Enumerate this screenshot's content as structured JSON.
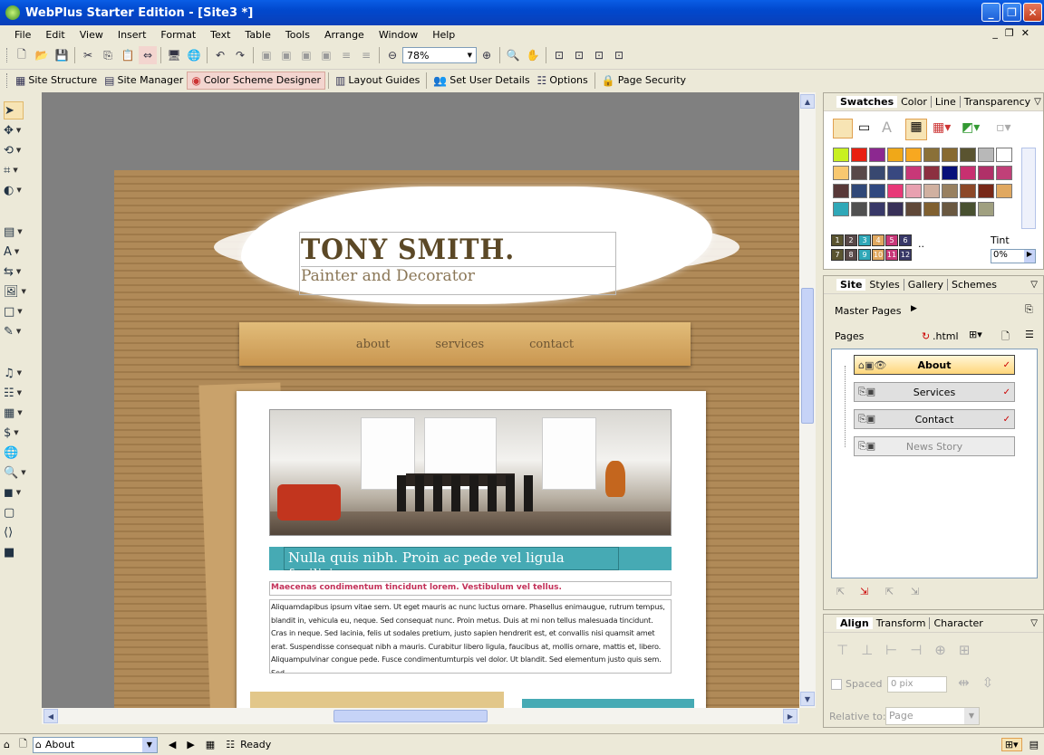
{
  "window": {
    "title": "WebPlus Starter Edition    - [Site3 *]"
  },
  "menu": [
    "File",
    "Edit",
    "View",
    "Insert",
    "Format",
    "Text",
    "Table",
    "Tools",
    "Arrange",
    "Window",
    "Help"
  ],
  "zoom": "78%",
  "toolbar2": {
    "site_structure": "Site Structure",
    "site_manager": "Site Manager",
    "color_scheme": "Color Scheme Designer",
    "layout_guides": "Layout Guides",
    "set_user_details": "Set User Details",
    "options": "Options",
    "page_security": "Page Security"
  },
  "page": {
    "name": "TONY SMITH.",
    "subtitle": "Painter and Decorator",
    "nav": [
      "about",
      "services",
      "contact"
    ],
    "banner": "Nulla quis nibh. Proin ac pede vel ligula facilisis",
    "red_heading": "Maecenas condimentum tincidunt lorem. Vestibulum vel tellus.",
    "body": "Aliquamdapibus ipsum vitae sem. Ut eget mauris ac nunc luctus ornare. Phasellus enimaugue, rutrum tempus, blandit in, vehicula eu, neque. Sed consequat nunc. Proin metus. Duis at mi non tellus malesuada tincidunt. Cras in neque. Sed lacinia, felis ut sodales pretium, justo sapien hendrerit est, et convallis nisi quamsit amet erat. Suspendisse consequat nibh a mauris. Curabitur libero ligula, faucibus at, mollis ornare, mattis et, libero. Aliquampulvinar congue pede. Fusce condimentumturpis vel dolor. Ut blandit. Sed elementum justo quis sem. Sed"
  },
  "swatches": {
    "tabs": [
      "Swatches",
      "Color",
      "Line",
      "Transparency"
    ],
    "colors": [
      "#c8f020",
      "#e82010",
      "#8c2890",
      "#f0a818",
      "#f8a820",
      "#8a7038",
      "#886a30",
      "#5a5430",
      "#b8b8b8",
      "#ffffff",
      "#f8c870",
      "#584848",
      "#384870",
      "#384880",
      "#c83878",
      "#8c3040",
      "#08107a",
      "#c83070",
      "#b03068",
      "#c04078",
      "#583838",
      "#304878",
      "#304880",
      "#e83878",
      "#e8a0b0",
      "#d0b0a0",
      "#988060",
      "#8c4828",
      "#782818",
      "#e0a860",
      "#30a8b8",
      "#505050",
      "#383868",
      "#383058",
      "#604838",
      "#806030",
      "#6a5840",
      "#485030",
      "#a0a080"
    ],
    "scheme_numbers": [
      "1",
      "2",
      "3",
      "4",
      "5",
      "6",
      "7",
      "8",
      "9",
      "10",
      "11",
      "12"
    ],
    "more": "..",
    "tint_label": "Tint",
    "tint_value": "0%"
  },
  "site_panel": {
    "tabs": [
      "Site",
      "Styles",
      "Gallery",
      "Schemes"
    ],
    "master_pages": "Master Pages",
    "pages_label": "Pages",
    "html_label": ".html",
    "pages": [
      "About",
      "Services",
      "Contact",
      "News Story"
    ]
  },
  "align_panel": {
    "tabs": [
      "Align",
      "Transform",
      "Character"
    ],
    "spaced": "Spaced",
    "spacing_value": "0 pix",
    "relative_label": "Relative to:",
    "relative_value": "Page"
  },
  "status": {
    "page": "About",
    "text": "Ready"
  }
}
